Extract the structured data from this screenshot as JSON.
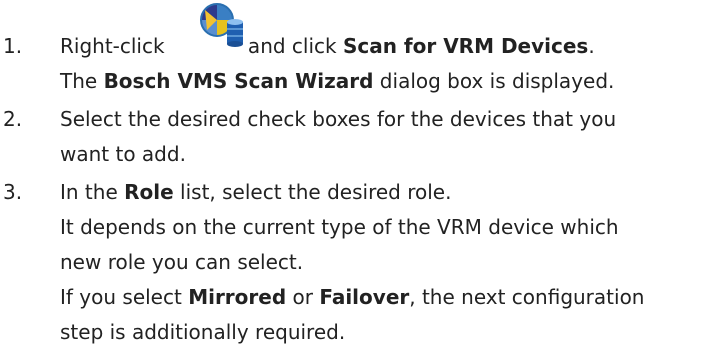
{
  "steps": [
    {
      "number": "1.",
      "line1": {
        "pre": "Right-click",
        "icon": "vrm-device-icon",
        "mid": " and click ",
        "bold": "Scan for VRM Devices",
        "post": "."
      },
      "line2": {
        "pre": "The ",
        "bold": "Bosch VMS Scan Wizard",
        "post": " dialog box is displayed."
      }
    },
    {
      "number": "2.",
      "line1": "Select the desired check boxes for the devices that you",
      "line2": "want to add."
    },
    {
      "number": "3.",
      "line1": {
        "pre": "In the ",
        "bold": "Role",
        "post": " list, select the desired role."
      },
      "line2": "It depends on the current type of the VRM device which",
      "line3": "new role you can select.",
      "line4": {
        "pre": "If you select ",
        "bold1": "Mirrored",
        "mid": " or ",
        "bold2": "Failover",
        "post": ", the next configuration"
      },
      "line5": "step is additionally required."
    }
  ]
}
